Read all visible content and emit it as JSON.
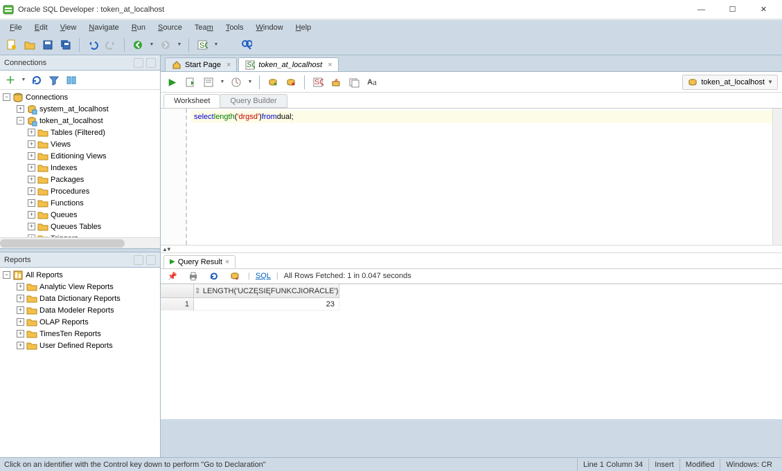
{
  "window": {
    "title": "Oracle SQL Developer : token_at_localhost"
  },
  "menu": [
    "File",
    "Edit",
    "View",
    "Navigate",
    "Run",
    "Source",
    "Team",
    "Tools",
    "Window",
    "Help"
  ],
  "connections_panel": {
    "title": "Connections",
    "root": "Connections",
    "items": [
      {
        "label": "system_at_localhost",
        "depth": 1,
        "icon": "db"
      },
      {
        "label": "token_at_localhost",
        "depth": 1,
        "icon": "db",
        "expanded": true
      },
      {
        "label": "Tables (Filtered)",
        "depth": 2,
        "icon": "folder"
      },
      {
        "label": "Views",
        "depth": 2,
        "icon": "folder"
      },
      {
        "label": "Editioning Views",
        "depth": 2,
        "icon": "folder"
      },
      {
        "label": "Indexes",
        "depth": 2,
        "icon": "folder"
      },
      {
        "label": "Packages",
        "depth": 2,
        "icon": "folder"
      },
      {
        "label": "Procedures",
        "depth": 2,
        "icon": "folder"
      },
      {
        "label": "Functions",
        "depth": 2,
        "icon": "folder"
      },
      {
        "label": "Queues",
        "depth": 2,
        "icon": "folder"
      },
      {
        "label": "Queues Tables",
        "depth": 2,
        "icon": "folder"
      },
      {
        "label": "Triggers",
        "depth": 2,
        "icon": "folder",
        "cut": true
      }
    ]
  },
  "reports_panel": {
    "title": "Reports",
    "root": "All Reports",
    "items": [
      "Analytic View Reports",
      "Data Dictionary Reports",
      "Data Modeler Reports",
      "OLAP Reports",
      "TimesTen Reports",
      "User Defined Reports"
    ]
  },
  "tabs": {
    "start": "Start Page",
    "file": "token_at_localhost"
  },
  "connection_pill": "token_at_localhost",
  "worksheet_tabs": {
    "worksheet": "Worksheet",
    "builder": "Query Builder"
  },
  "sql": {
    "tokens": [
      {
        "t": "select",
        "c": "kw"
      },
      {
        "t": " ",
        "c": "id"
      },
      {
        "t": "length",
        "c": "pn"
      },
      {
        "t": "(",
        "c": "id"
      },
      {
        "t": "'drgsd'",
        "c": "str"
      },
      {
        "t": ")",
        "c": "id"
      },
      {
        "t": " ",
        "c": "id"
      },
      {
        "t": "from",
        "c": "kw"
      },
      {
        "t": " ",
        "c": "id"
      },
      {
        "t": "dual",
        "c": "id"
      },
      {
        "t": ";",
        "c": "id"
      }
    ]
  },
  "result": {
    "tab": "Query Result",
    "sql_link": "SQL",
    "status": "All Rows Fetched: 1 in 0.047 seconds",
    "column": "LENGTH('UCZĘSIĘFUNKCJIORACLE')",
    "rownum": "1",
    "value": "23"
  },
  "statusbar": {
    "hint": "Click on an identifier with the Control key down to perform \"Go to Declaration\"",
    "pos": "Line 1 Column 34",
    "insert": "Insert",
    "modified": "Modified",
    "platform": "Windows: CR"
  }
}
